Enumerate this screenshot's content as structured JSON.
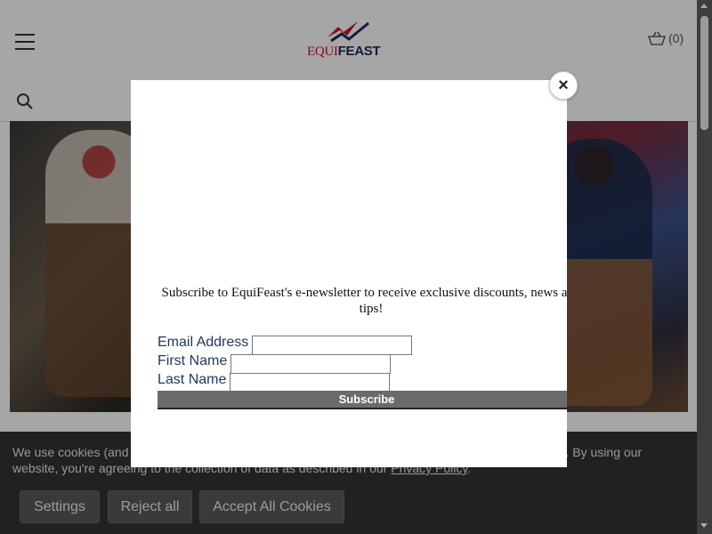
{
  "header": {
    "logo": {
      "part1": "EQUI",
      "part2": "FEAST"
    },
    "cart": {
      "count_text": "(0)"
    }
  },
  "icons": {
    "menu": "hamburger-menu-icon",
    "search": "search-icon",
    "cart": "basket-icon",
    "close": "close-icon"
  },
  "popup": {
    "close_label": "×",
    "description": "Subscribe to EquiFeast's e-newsletter to receive exclusive discounts, news and tips!",
    "fields": {
      "email_label": "Email Address",
      "first_name_label": "First Name",
      "last_name_label": "Last Name"
    },
    "subscribe_label": "Subscribe"
  },
  "cookie_banner": {
    "text_start": "We use cookies (and other similar technologies) to collect data to improve your shopping experience. By using our website, you're agreeing to the collection of data as described in our ",
    "privacy_link": "Privacy Policy",
    "text_end": ".",
    "buttons": {
      "settings": "Settings",
      "reject": "Reject all",
      "accept": "Accept All Cookies"
    }
  },
  "colors": {
    "brand_red": "#c8102e",
    "brand_navy": "#1d2a5b",
    "cookie_bg": "#333333"
  }
}
